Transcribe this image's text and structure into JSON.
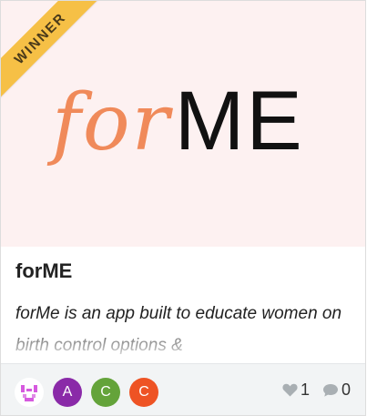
{
  "card": {
    "ribbon_text": "WINNER",
    "logo": {
      "part_italic": "for",
      "part_bold": "ME"
    },
    "title": "forME",
    "description": "forMe is an app built to educate women on birth control options &",
    "thumbnail_bg": "#fdf1f1",
    "ribbon_color": "#f6c046"
  },
  "footer": {
    "avatars": [
      {
        "type": "image",
        "icon": "pixel-face-icon"
      },
      {
        "type": "initial",
        "letter": "A",
        "color": "#8a2aa8"
      },
      {
        "type": "initial",
        "letter": "C",
        "color": "#64a33a"
      },
      {
        "type": "initial",
        "letter": "C",
        "color": "#ee5324"
      }
    ],
    "likes": "1",
    "comments": "0",
    "like_icon": "heart-icon",
    "comment_icon": "speech-bubble-icon"
  }
}
